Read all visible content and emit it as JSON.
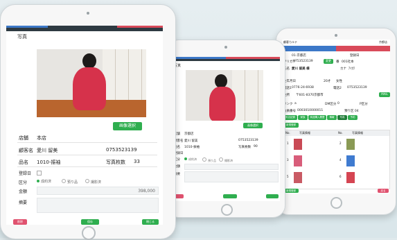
{
  "front": {
    "title": "写真",
    "image_select_btn": "画像選択",
    "store_label": "店舗",
    "store_value": "本店",
    "customer_label": "顧客名",
    "customer_value": "愛川 留美",
    "phone": "0753523139",
    "product_label": "品名",
    "product_value": "1010-振袖",
    "photo_count_label": "写真枚数",
    "photo_count_value": "33",
    "register_label": "登録日",
    "category_label": "区分",
    "category_options": [
      "成約済",
      "預り品",
      "撮影済"
    ],
    "amount_label": "金額",
    "amount_value": "398,000",
    "memo_label": "摘要",
    "delete_btn": "削除",
    "save_btn": "保存",
    "close_btn": "閉じる"
  },
  "middle": {
    "title": "写真",
    "image_select_btn": "画像選択",
    "store_label": "店舗",
    "store_value": "京都店",
    "customer_label": "顧客名",
    "customer_value": "愛川 留美",
    "phone": "0753523139",
    "product_label": "品名",
    "product_value": "1010-振袖",
    "photo_count_label": "写真枚数",
    "photo_count_value": "90",
    "register_label": "登録日",
    "category_label": "区分",
    "category_options": [
      "成約済",
      "預り品",
      "撮影済"
    ],
    "amount_label": "金額",
    "memo_label": "摘要"
  },
  "right": {
    "header_left": "顧客カルテ",
    "header_right": "京都店",
    "store": "01-京都店",
    "register_label": "登録日",
    "furigana_label": "フリガナ",
    "phone": "0753523139",
    "edit_btn": "変更",
    "member_label": "番",
    "member_no": "001社本",
    "name_label": "氏名",
    "name_value": "愛川 留美 様",
    "kana_label": "カナ",
    "kana_value": "ｱｲｶﾜ",
    "birth_label": "生年月日",
    "age_value": "20才",
    "gender_value": "女性",
    "phone1_label": "電話1",
    "phone1_value": "0776-24-6938",
    "phone2_label": "電話2",
    "phone2_value": "0753523139",
    "address_label": "住所",
    "address_value": "〒601-8370京都市",
    "mail_btn": "MAIL",
    "rank_label": "ランク",
    "rank_value": "a",
    "dm_label": "DM区分",
    "dm_value": "0",
    "p_label": "P区分",
    "cert_label": "会員番号",
    "cert_value": "0003010000011",
    "ka_label": "預り区 04",
    "tabs": [
      "来店記録",
      "家族",
      "商品購入履歴",
      "情報",
      "写真",
      "予約"
    ],
    "new_btn": "新規登録",
    "table_headers": [
      "No.",
      "写真情報",
      "No.",
      "写真情報"
    ],
    "rows": [
      {
        "no": "1",
        "no2": "2"
      },
      {
        "no": "3",
        "no2": "4"
      },
      {
        "no": "5",
        "no2": "6"
      }
    ],
    "new_btn_bottom": "新規登録",
    "back_btn": "戻る"
  }
}
